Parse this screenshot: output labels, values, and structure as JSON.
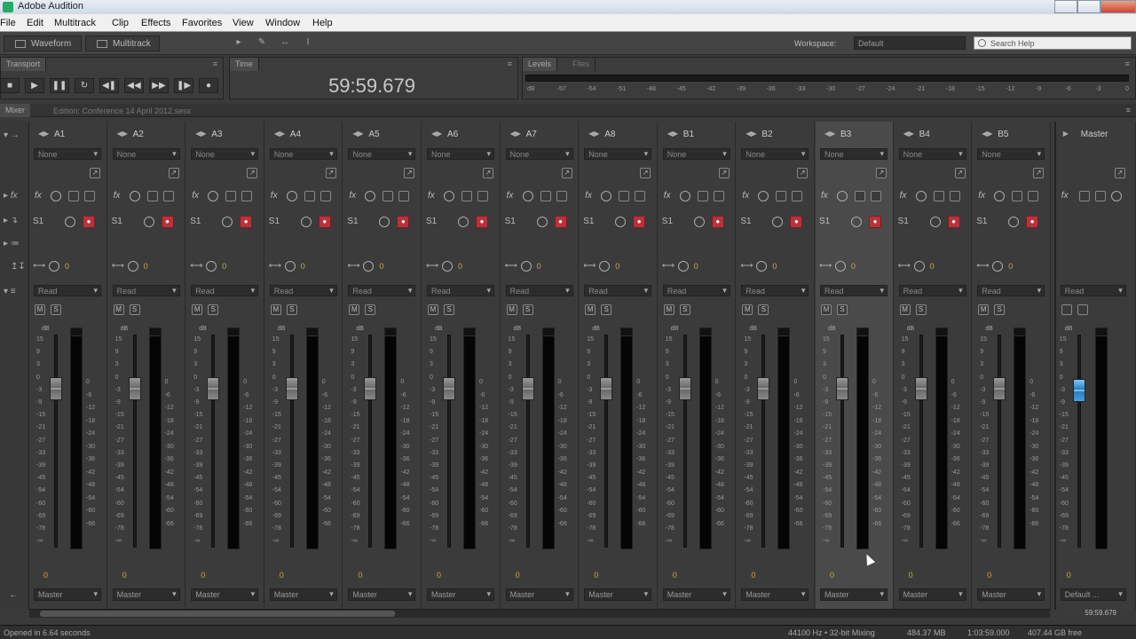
{
  "window": {
    "title": "Adobe Audition"
  },
  "menu": [
    "File",
    "Edit",
    "Multitrack",
    "Clip",
    "Effects",
    "Favorites",
    "View",
    "Window",
    "Help"
  ],
  "toolbar": {
    "waveform_label": "Waveform",
    "multitrack_label": "Multitrack",
    "workspace_label": "Workspace:",
    "workspace_value": "Default",
    "search_placeholder": "Search Help"
  },
  "transport": {
    "tab": "Transport"
  },
  "time": {
    "tab": "Time",
    "value": "59:59.679"
  },
  "levels": {
    "tab": "Levels",
    "tab2": "Files",
    "ticks": [
      "dB",
      "-57",
      "-54",
      "-51",
      "-48",
      "-45",
      "-42",
      "-39",
      "-36",
      "-33",
      "-30",
      "-27",
      "-24",
      "-21",
      "-18",
      "-15",
      "-12",
      "-9",
      "-6",
      "-3",
      "0"
    ]
  },
  "mixer": {
    "tab": "Mixer",
    "session": "Edition: Conference 14 April 2012.sesx",
    "input_default": "None",
    "send_label": "S1",
    "automation_default": "Read",
    "pan_value": "0",
    "db_label": "dB",
    "fader_scale": [
      "15",
      "9",
      "3",
      "0",
      "-3",
      "-9",
      "-15",
      "-21",
      "-27",
      "-33",
      "-39",
      "-45",
      "-54",
      "-60",
      "-69",
      "-78",
      "-∞"
    ],
    "meter_scale": [
      "0",
      "-6",
      "-12",
      "-18",
      "-24",
      "-30",
      "-36",
      "-42",
      "-48",
      "-54",
      "-60",
      "-66"
    ],
    "strips": [
      {
        "name": "A1",
        "output": "Master"
      },
      {
        "name": "A2",
        "output": "Master"
      },
      {
        "name": "A3",
        "output": "Master"
      },
      {
        "name": "A4",
        "output": "Master"
      },
      {
        "name": "A5",
        "output": "Master"
      },
      {
        "name": "A6",
        "output": "Master"
      },
      {
        "name": "A7",
        "output": "Master"
      },
      {
        "name": "A8",
        "output": "Master"
      },
      {
        "name": "B1",
        "output": "Master"
      },
      {
        "name": "B2",
        "output": "Master"
      },
      {
        "name": "B3",
        "output": "Master"
      },
      {
        "name": "B4",
        "output": "Master"
      },
      {
        "name": "B5",
        "output": "Master"
      }
    ],
    "master": {
      "name": "Master",
      "output": "Default ...",
      "time": "59:59.679"
    }
  },
  "status": {
    "message": "Opened in 6.64 seconds",
    "format": "44100 Hz • 32-bit Mixing",
    "size": "484.37 MB",
    "duration": "1:03:59.000",
    "free": "407.44 GB free"
  },
  "colors": {
    "record_button": "#b7333c",
    "master_fader": "#2a7fc0",
    "pan_value": "#c9a54a"
  }
}
